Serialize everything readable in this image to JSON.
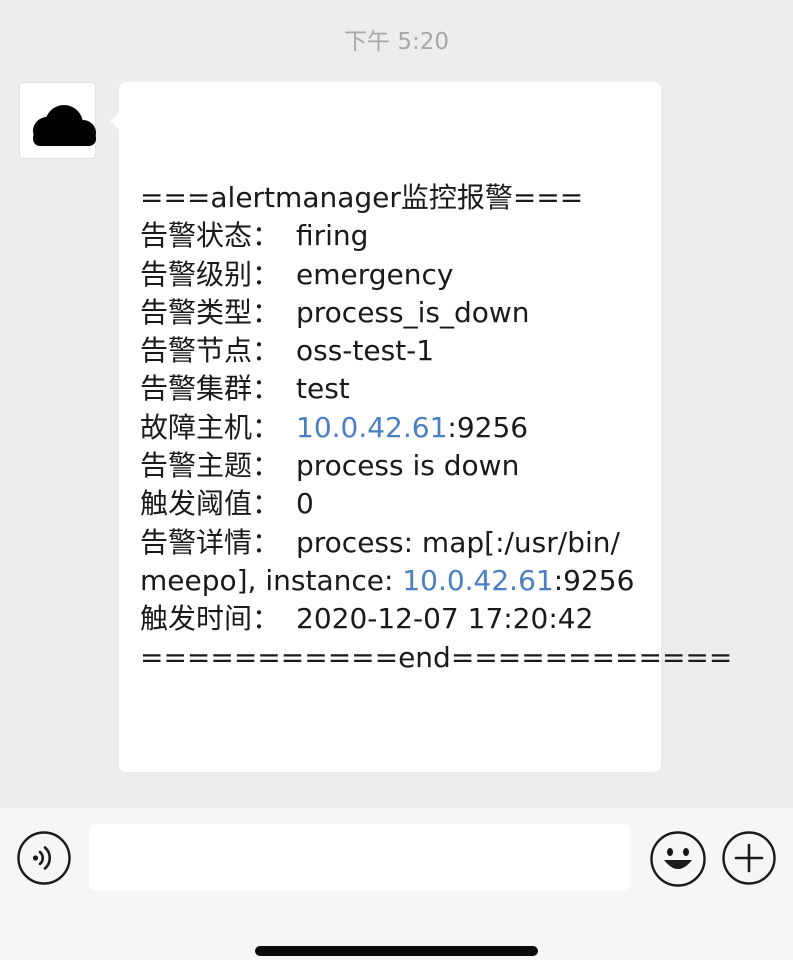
{
  "timestamp": "下午 5:20",
  "avatar": {
    "icon": "cloud-icon"
  },
  "message": {
    "header": "===alertmanager监控报警===",
    "fields": [
      {
        "label": "告警状态：",
        "value": "firing"
      },
      {
        "label": "告警级别：",
        "value": "emergency"
      },
      {
        "label": "告警类型：",
        "value": "process_is_down"
      },
      {
        "label": "告警节点：",
        "value": "oss-test-1"
      },
      {
        "label": "告警集群：",
        "value": "test"
      }
    ],
    "host": {
      "label": "故障主机：",
      "ip": "10.0.42.61",
      "port": ":9256"
    },
    "subject": {
      "label": "告警主题：",
      "value": "process is down"
    },
    "threshold": {
      "label": "触发阈值：",
      "value": "0"
    },
    "details": {
      "label": "告警详情：",
      "value_line1": "process: map[:/usr/bin/",
      "value_line2_prefix": "meepo], instance: ",
      "ip": "10.0.42.61",
      "port": ":9256"
    },
    "trigger_time": {
      "label": "触发时间：",
      "value": "2020-12-07 17:20:42"
    },
    "footer": "===========end============"
  },
  "input_bar": {
    "voice_icon": "voice-icon",
    "emoji_icon": "emoji-icon",
    "plus_icon": "plus-icon",
    "input_value": ""
  },
  "colors": {
    "link": "#4a7fc1",
    "background": "#ededed",
    "bubble": "#ffffff"
  }
}
